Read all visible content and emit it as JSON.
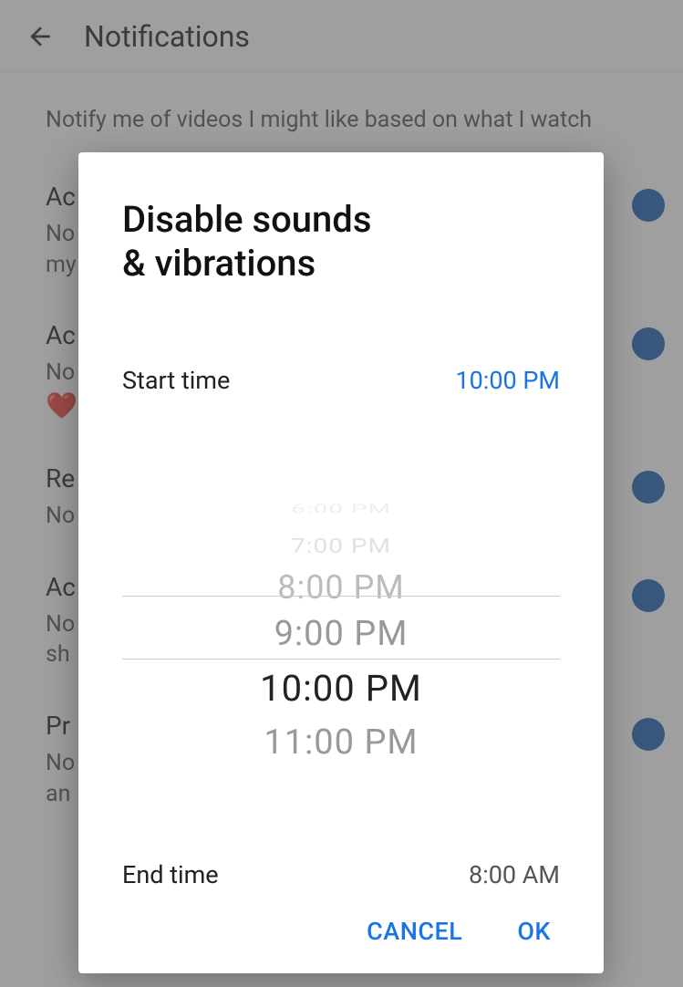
{
  "header": {
    "title": "Notifications"
  },
  "background": {
    "description": "Notify me of videos I might like based on what I watch",
    "settings": [
      {
        "title": "Ac",
        "subtitle_line1": "No",
        "subtitle_line2": "my"
      },
      {
        "title": "Ac",
        "subtitle_line1": "No",
        "heart": "❤️"
      },
      {
        "title": "Re",
        "subtitle_line1": "No"
      },
      {
        "title": "Ac",
        "subtitle_line1": "No",
        "subtitle_line2": "sh"
      },
      {
        "title": "Pr",
        "subtitle_line1": "No",
        "subtitle_line2": "an"
      }
    ]
  },
  "dialog": {
    "title_line1": "Disable sounds",
    "title_line2": "& vibrations",
    "start_label": "Start time",
    "start_value": "10:00 PM",
    "end_label": "End time",
    "end_value": "8:00 AM",
    "picker_options": [
      "6:00 PM",
      "7:00 PM",
      "8:00 PM",
      "9:00 PM",
      "10:00 PM",
      "11:00 PM"
    ],
    "cancel_label": "CANCEL",
    "ok_label": "OK"
  }
}
